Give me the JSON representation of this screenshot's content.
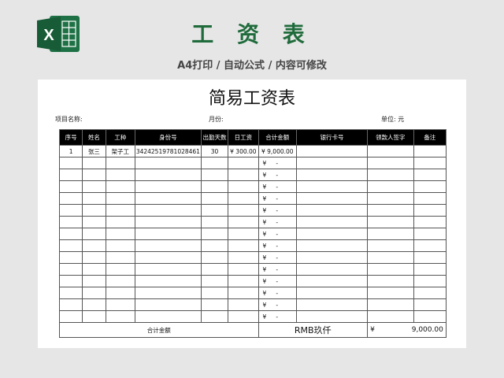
{
  "header": {
    "title": "工 资 表",
    "subtitle": "A4打印 / 自动公式 / 内容可修改"
  },
  "sheet": {
    "title": "简易工资表",
    "project_label": "项目名称:",
    "month_label": "月份:",
    "unit_label": "单位: 元"
  },
  "table": {
    "headers": [
      "序号",
      "姓名",
      "工种",
      "身份号",
      "出勤天数",
      "日工资",
      "合计金额",
      "银行卡号",
      "领款人签字",
      "备注"
    ],
    "first_row": [
      "1",
      "张三",
      "架子工",
      "342425197810284​61",
      "30",
      "¥ 300.00",
      "¥  9,000.00",
      "",
      "",
      ""
    ],
    "empty_amount": "¥",
    "empty_dash": "-",
    "total_label": "合计金额",
    "total_words": "RMB玖仟",
    "total_currency": "¥",
    "total_value": "9,000.00"
  },
  "colors": {
    "accent": "#1f6b3b",
    "excel_green": "#1e7145"
  },
  "icons": {
    "logo": "excel-icon"
  }
}
